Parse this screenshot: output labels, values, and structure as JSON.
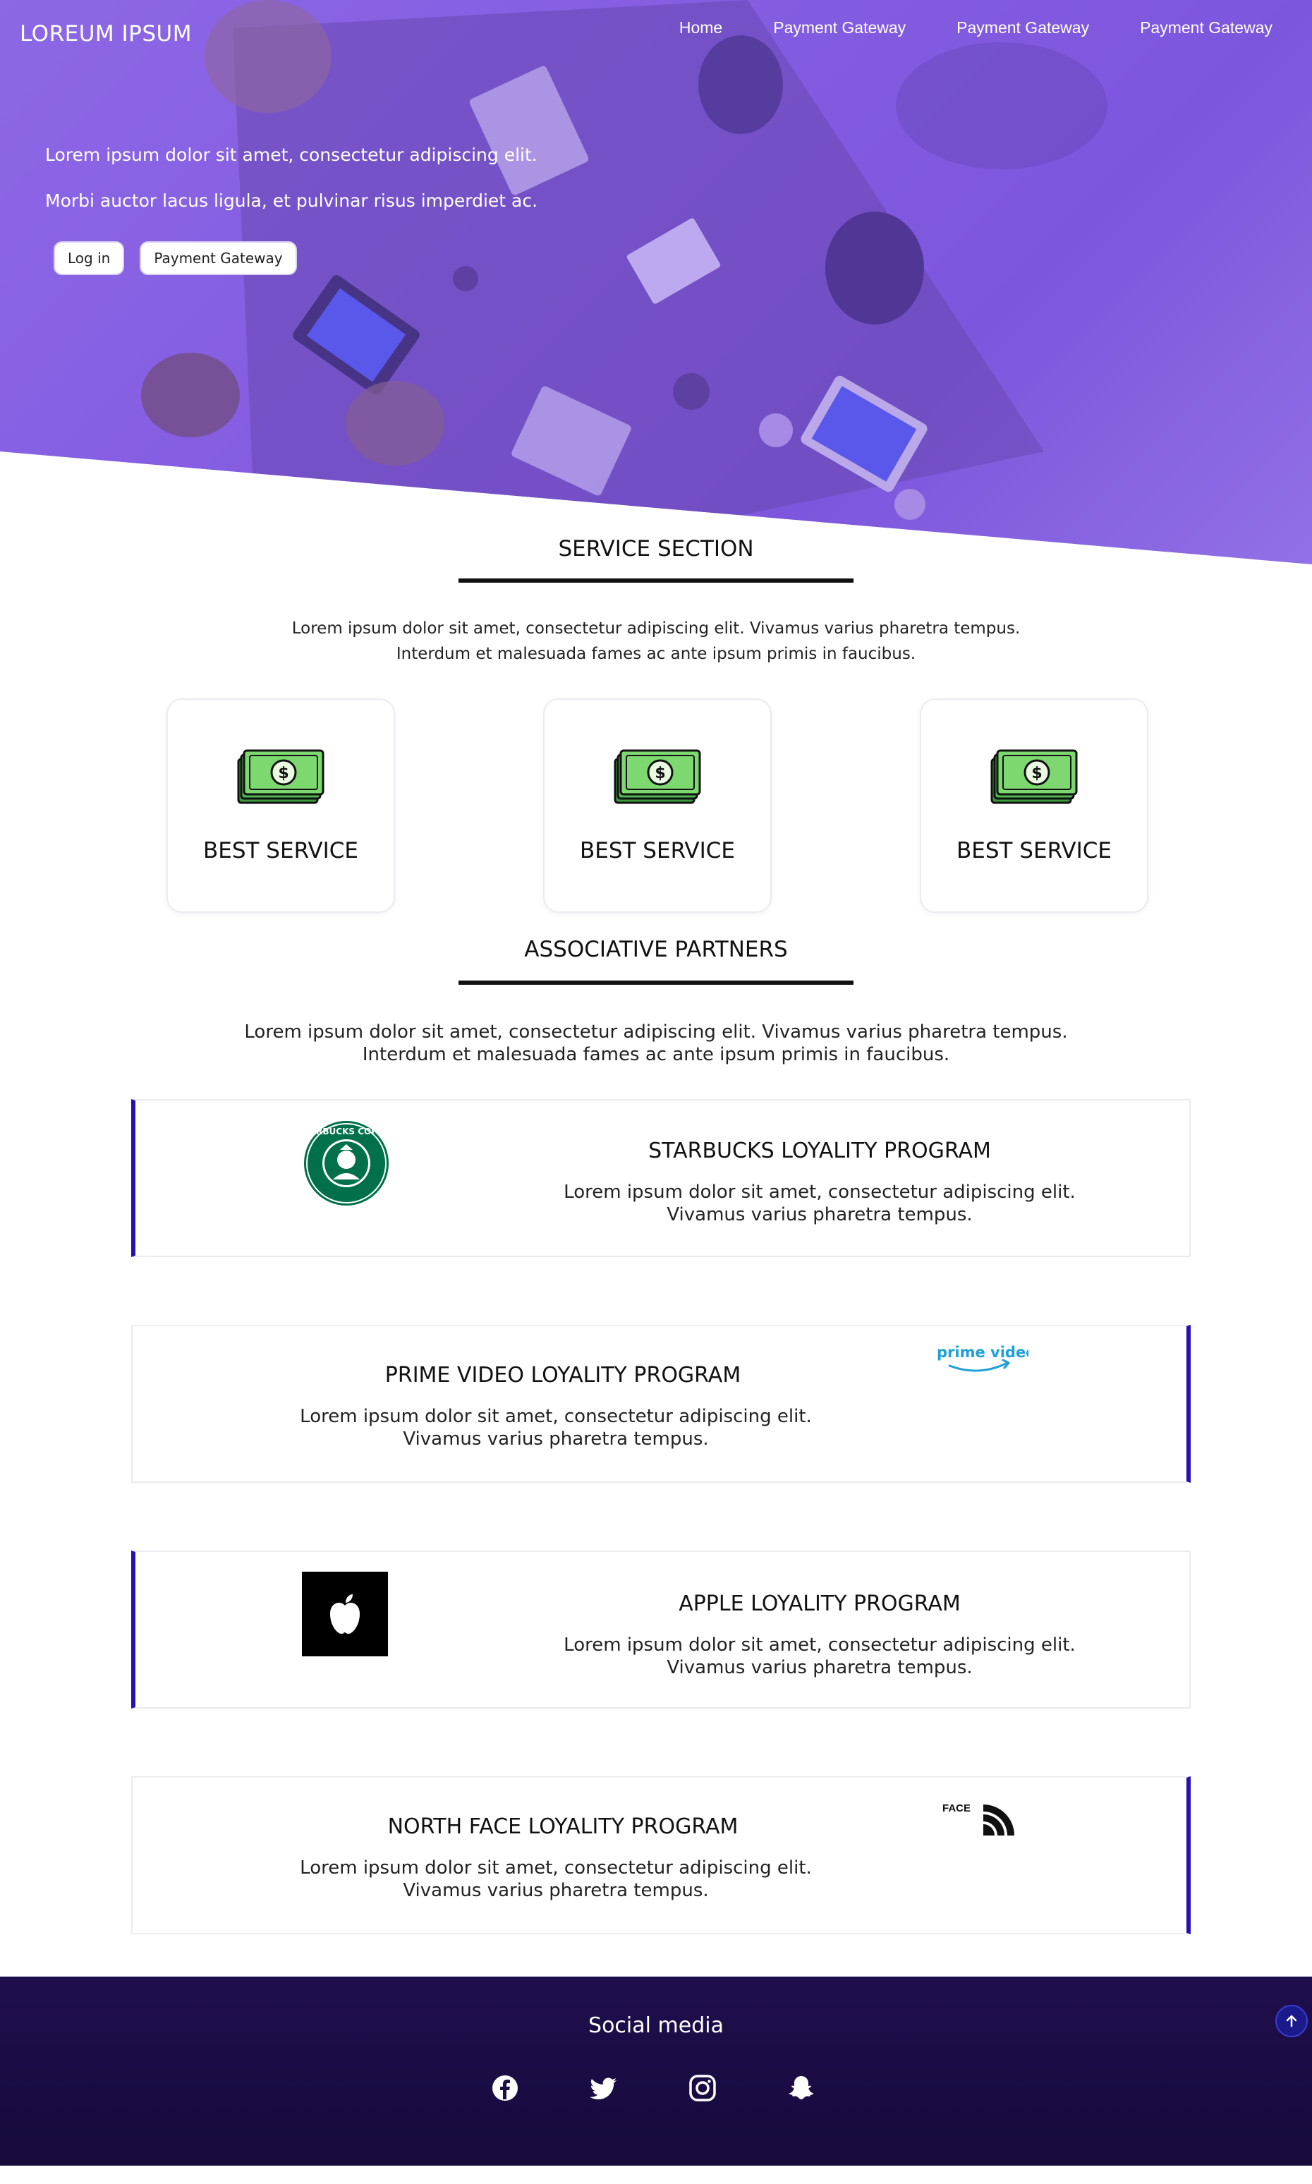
{
  "header": {
    "brand": "LOREUM IPSUM",
    "nav": [
      "Home",
      "Payment Gateway",
      "Payment Gateway",
      "Payment Gateway"
    ]
  },
  "hero": {
    "line1": "Lorem ipsum dolor sit amet, consectetur adipiscing elit.",
    "line2": "Morbi auctor lacus ligula, et pulvinar risus imperdiet ac.",
    "login_label": "Log in",
    "gateway_label": "Payment Gateway"
  },
  "services": {
    "title": "SERVICE SECTION",
    "text1": "Lorem ipsum dolor sit amet, consectetur adipiscing elit. Vivamus varius pharetra tempus.",
    "text2": "Interdum et malesuada fames ac ante ipsum primis in faucibus.",
    "cards": [
      {
        "label": "BEST SERVICE",
        "icon": "money-icon"
      },
      {
        "label": "BEST SERVICE",
        "icon": "money-icon"
      },
      {
        "label": "BEST SERVICE",
        "icon": "money-icon"
      }
    ]
  },
  "partners": {
    "title": "ASSOCIATIVE PARTNERS",
    "text1": "Lorem ipsum dolor sit amet, consectetur adipiscing elit. Vivamus varius pharetra tempus.",
    "text2": "Interdum et malesuada fames ac ante ipsum primis in faucibus.",
    "items": [
      {
        "title": "STARBUCKS LOYALITY PROGRAM",
        "desc1": "Lorem ipsum dolor sit amet, consectetur adipiscing elit.",
        "desc2": "Vivamus varius pharetra tempus.",
        "logo": "starbucks-logo",
        "logo_text": "STARBUCKS COFFEE"
      },
      {
        "title": "PRIME VIDEO LOYALITY PROGRAM",
        "desc1": "Lorem ipsum dolor sit amet, consectetur adipiscing elit.",
        "desc2": "Vivamus varius pharetra tempus.",
        "logo": "prime-video-logo",
        "logo_text": "prime video"
      },
      {
        "title": "APPLE LOYALITY PROGRAM",
        "desc1": "Lorem ipsum dolor sit amet, consectetur adipiscing elit.",
        "desc2": "Vivamus varius pharetra tempus.",
        "logo": "apple-logo"
      },
      {
        "title": "NORTH FACE LOYALITY PROGRAM",
        "desc1": "Lorem ipsum dolor sit amet, consectetur adipiscing elit.",
        "desc2": "Vivamus varius pharetra tempus.",
        "logo": "north-face-logo",
        "logo_text": "THE NORTH FACE"
      }
    ]
  },
  "footer": {
    "title": "Social media",
    "icons": [
      "facebook-icon",
      "twitter-icon",
      "instagram-icon",
      "snapchat-icon"
    ],
    "scroll_icon": "arrow-up-icon"
  },
  "colors": {
    "hero_overlay": "#7c52e2",
    "accent_bar": "#2a0fb0",
    "footer_bg": "#1f0e4c"
  }
}
